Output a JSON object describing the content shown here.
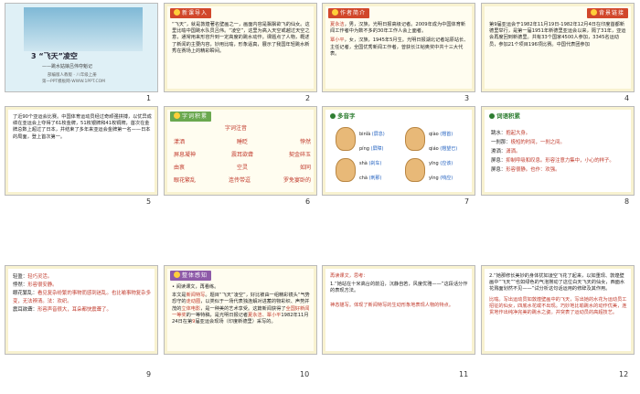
{
  "slides": [
    {
      "number": "1",
      "title": "3 “飞天”凌空",
      "subtitle": "——跳水姑娘吕伟夺魁记",
      "publisher": "部编版人教版 · 八年级上册",
      "site": "第一PPT模板网-WWW.1PPT.COM"
    },
    {
      "number": "2",
      "tag": "新课导入",
      "text": "“飞天”，就是敦煌著名壁画之一，画面内容是飘飘欲飞的仙女。这里比喻中国跳水队员吕伟。“凌空”，这里为高入天空或越过天空之意，通常用来形容升到一定高度的跳水动作。课题点了人物，概述了新闻的主要内容，妙用比喻，形象逼真，展示了我国年轻跳水新秀在赛场上的精彩瞬间。"
    },
    {
      "number": "3",
      "tag": "作者简介",
      "p1_name": "夏永洁",
      "p1": "，男，汉族，光明日报高级记者。2009年成为中国体育新闻工作者中为数不多的30年工作人会上面者。",
      "p2_name": "覃小平",
      "p2": "，女，汉族，1945年5月生。光明日报湖北记者站原站长、主任记者，全国优秀新闻工作者，曾获长江韬奥奖中共十三大代表。"
    },
    {
      "number": "4",
      "tag": "背景链接",
      "text": "第9届亚运会于1982年11月19日-1982年12月4日在印度首都新德里举行，是第一届1951年新德里亚运会以来，隔了31年，亚运会再度回到新德里。共有33个国家4500人参加，3345名运动员，参加21个项目196项比赛。中国代表团参加"
    },
    {
      "number": "5",
      "text": "了近90个亚运会比赛。中国体育运动员经过奇顽强拼搏，以优异成绩在亚运会上夺得了61枚金牌，51枚银牌和41枚铜牌，首次在金牌总数上超过了日本，并结束了多年来亚运会金牌第一名——日本的局面，登上首次第一。"
    },
    {
      "number": "6",
      "tag": "字词积累",
      "heading": "字词注音",
      "rows": [
        [
          "漾洒",
          "睡眨",
          "悖然"
        ],
        [
          "屏息凝神",
          "震耳欲聋",
          "契金碎玉"
        ],
        [
          "由衷",
          "空灵",
          "如同"
        ],
        [
          "眼花繁乱",
          "连传带逗",
          "罗免宴卧的"
        ]
      ]
    },
    {
      "number": "7",
      "header": "多音字",
      "left": [
        {
          "py": "binǐà",
          "word": "屏息"
        },
        {
          "py": "píng",
          "word": "屏障"
        },
        {
          "py": "shà",
          "word": "刹车"
        },
        {
          "py": "chà",
          "word": "刺那"
        }
      ],
      "right": [
        {
          "py": "qiào",
          "word": "翘首"
        },
        {
          "py": "qiáo",
          "word": "翘望已"
        },
        {
          "py": "yīng",
          "word": "应该"
        },
        {
          "py": "yìng",
          "word": "响应"
        }
      ]
    },
    {
      "number": "8",
      "header": "词语积累",
      "items": [
        {
          "term": "跳水：",
          "def": "抱起大身。"
        },
        {
          "term": "一刹那：",
          "def": "极短的时间，一刹之间。"
        },
        {
          "term": "潫洒：",
          "def": "潇洒。"
        },
        {
          "term": "屏息：",
          "def": "抑制呼吸和叹息。形容注意力集中，小心的样子。"
        },
        {
          "term": "屏息：",
          "def": "形容很静。也作：欢强。"
        }
      ]
    },
    {
      "number": "9",
      "items": [
        {
          "term": "轻盈：",
          "def": "轻巧灵活。"
        },
        {
          "term": "悖然：",
          "def": "形容很安静。"
        },
        {
          "term": "眼花繁乱：",
          "def": "看见复杂纷繁的事物而感到迷乱。也比喻事物复杂多变，无法辨清。法：欢织。"
        },
        {
          "term": "震耳欲聋：",
          "def": "形容声音很大，耳朵都快震聋了。"
        }
      ]
    },
    {
      "number": "10",
      "tag": "整体感知",
      "q": "• 阅读课文，再看练。",
      "p_a": "本文是",
      "b1": "新闻特写",
      "p_b": "。题目“飞天”凌空”，好比被由一组精彩镜头“气势恐守的",
      "b2": "走动圈",
      "p_c": "，以类似于一场代表独连解对进蓄的物彩织、声势并茂的",
      "b3": "立体电影",
      "p_d": "，是一种美的艺术享受。这篇新闻获得了",
      "b4": "全国好新闻一等奖",
      "p_e": "的一等特稿，是光明日报记者",
      "b5": "夏永洁、覃小平",
      "p_f": "1982年11月24日在第",
      "b6": "9",
      "p_g": "届亚运会现场（印度新德里）采写的。"
    },
    {
      "number": "11",
      "heading": "再读课文，思考：",
      "q": "1.“她站在十米高台的前沿，沉静自若，风度优雅——”这段话分作的表现方法。",
      "a": "神态描写。体现了新闻特写的生动形象地表现人物的特点。"
    },
    {
      "number": "12",
      "q": "2.“她那修长美妙的身体犹如凌空飞花了起来，以如重现、敦煌壁画中“飞天””也如绿色的气泡撈动了这位白天飞天的仙女，西面水花溅面划然不见——”试分析这句话运用的修辞及其作用。",
      "a": "比喻。写出运动员如敦煌壁画中的飞天，写出她的水花为运动员工招征的仙女，四底水花或不出现。巧妙地比喻跳水的动作优美，连贯地作出纯净完美的跳水之姿。并突表了运动员的高超技艺。"
    }
  ]
}
